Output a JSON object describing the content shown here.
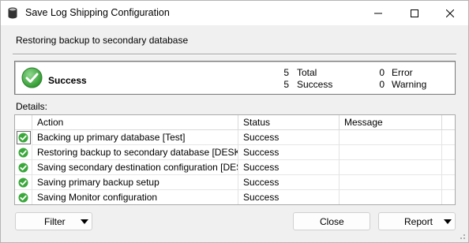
{
  "window": {
    "title": "Save Log Shipping Configuration",
    "icon": "database-icon"
  },
  "header": {
    "text": "Restoring backup to secondary database"
  },
  "summary": {
    "status": "Success",
    "status_icon": "success-check-icon",
    "total_count": "5",
    "total_label": "Total",
    "success_count": "5",
    "success_label": "Success",
    "error_count": "0",
    "error_label": "Error",
    "warning_count": "0",
    "warning_label": "Warning"
  },
  "details": {
    "label": "Details:",
    "columns": [
      "Action",
      "Status",
      "Message"
    ],
    "rows": [
      {
        "action": "Backing up primary database [Test]",
        "status": "Success",
        "message": "",
        "icon": "success-check-icon"
      },
      {
        "action": "Restoring backup to secondary database [DESK...",
        "status": "Success",
        "message": "",
        "icon": "success-check-icon"
      },
      {
        "action": "Saving secondary destination configuration [DES...",
        "status": "Success",
        "message": "",
        "icon": "success-check-icon"
      },
      {
        "action": "Saving primary backup setup",
        "status": "Success",
        "message": "",
        "icon": "success-check-icon"
      },
      {
        "action": "Saving Monitor configuration",
        "status": "Success",
        "message": "",
        "icon": "success-check-icon"
      }
    ]
  },
  "buttons": {
    "filter": "Filter",
    "close": "Close",
    "report": "Report"
  },
  "colors": {
    "success_green": "#3aa83a",
    "border": "#a9a9a9"
  }
}
